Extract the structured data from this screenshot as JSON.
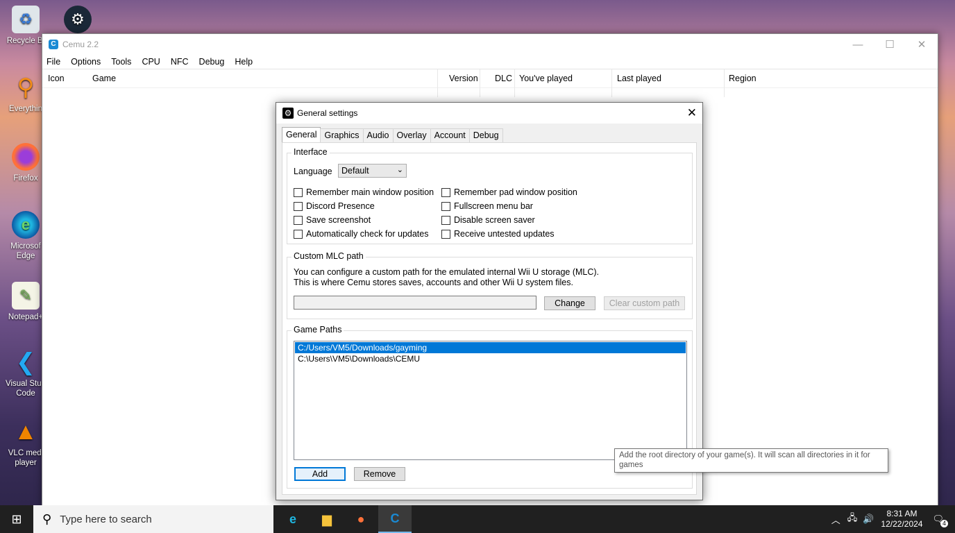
{
  "desktop": {
    "icons": [
      {
        "label": "Recycle Bin",
        "shown": "Recycle Bi",
        "icon": "recycle-bin-icon"
      },
      {
        "label": "Everything",
        "shown": "Everythin",
        "icon": "everything-icon"
      },
      {
        "label": "Firefox",
        "shown": "Firefox",
        "icon": "firefox-icon"
      },
      {
        "label": "Microsoft Edge",
        "shown1": "Microsof",
        "shown2": "Edge",
        "icon": "edge-icon"
      },
      {
        "label": "Notepad++",
        "shown": "Notepad+",
        "icon": "notepad-icon"
      },
      {
        "label": "Visual Studio Code",
        "shown1": "Visual Stud",
        "shown2": "Code",
        "icon": "vscode-icon"
      },
      {
        "label": "VLC media player",
        "shown1": "VLC medi",
        "shown2": "player",
        "icon": "vlc-icon"
      }
    ]
  },
  "main_window": {
    "title": "Cemu 2.2",
    "menu": [
      "File",
      "Options",
      "Tools",
      "CPU",
      "NFC",
      "Debug",
      "Help"
    ],
    "columns": [
      "Icon",
      "Game",
      "Version",
      "DLC",
      "You've played",
      "Last played",
      "Region"
    ]
  },
  "dialog": {
    "title": "General settings",
    "tabs": [
      "General",
      "Graphics",
      "Audio",
      "Overlay",
      "Account",
      "Debug"
    ],
    "active_tab": "General",
    "interface": {
      "label": "Interface",
      "language_label": "Language",
      "language_value": "Default",
      "checkboxes_left": [
        "Remember main window position",
        "Discord Presence",
        "Save screenshot",
        "Automatically check for updates"
      ],
      "checkboxes_right": [
        "Remember pad window position",
        "Fullscreen menu bar",
        "Disable screen saver",
        "Receive untested updates"
      ]
    },
    "mlc": {
      "label": "Custom MLC path",
      "desc1": "You can configure a custom path for the emulated internal Wii U storage (MLC).",
      "desc2": "This is where Cemu stores saves, accounts and other Wii U system files.",
      "path_value": "",
      "change_button": "Change",
      "clear_button": "Clear custom path"
    },
    "game_paths": {
      "label": "Game Paths",
      "items": [
        "C:/Users/VM5/Downloads/gayming",
        "C:\\Users\\VM5\\Downloads\\CEMU"
      ],
      "selected_index": 0,
      "add_button": "Add",
      "remove_button": "Remove"
    },
    "tooltip": "Add the root directory of your game(s). It will scan all directories in it for games"
  },
  "taskbar": {
    "search_placeholder": "Type here to search",
    "time": "8:31 AM",
    "date": "12/22/2024",
    "notifications": "4"
  },
  "colors": {
    "accent": "#0078d7",
    "taskbar": "#202020",
    "selection": "#0078d7"
  }
}
